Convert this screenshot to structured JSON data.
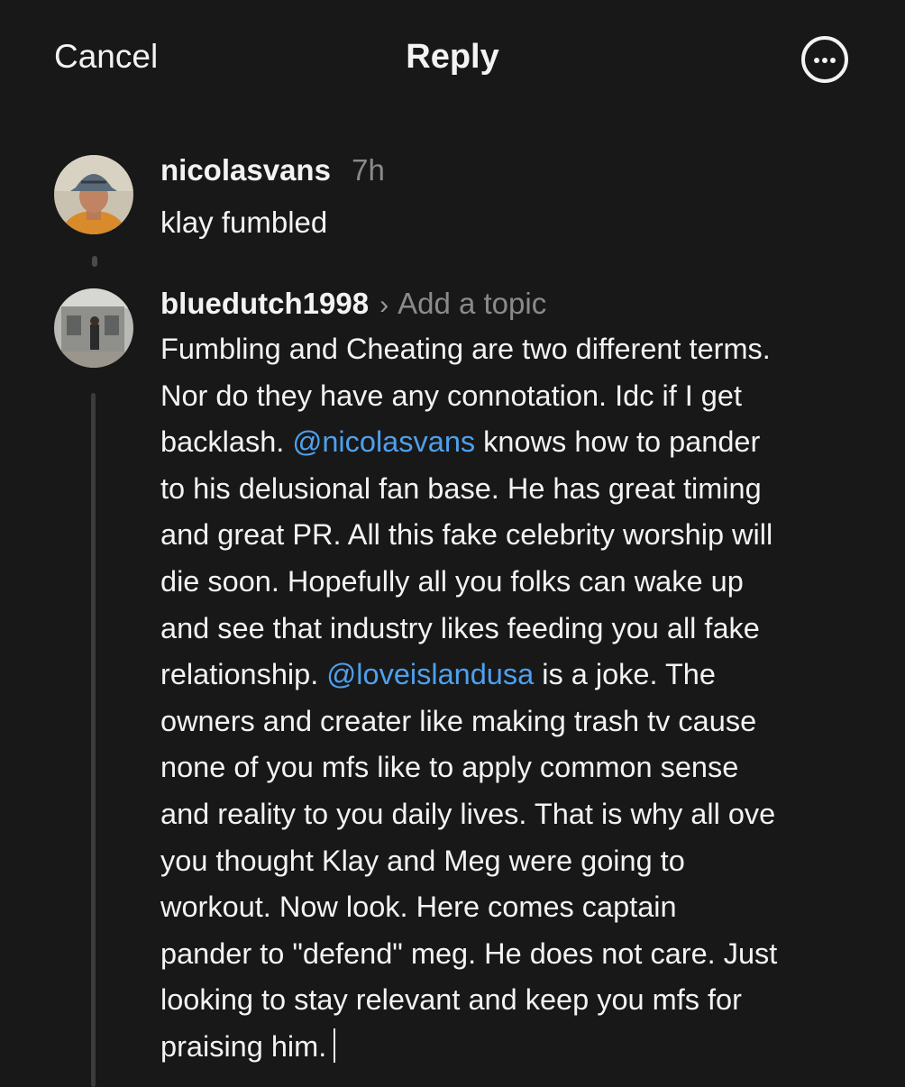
{
  "header": {
    "cancel_label": "Cancel",
    "title": "Reply",
    "more_icon": "more-options-icon"
  },
  "original_post": {
    "username": "nicolasvans",
    "time": "7h",
    "text": "klay fumbled",
    "avatar": "user-avatar"
  },
  "reply": {
    "username": "bluedutch1998",
    "topic_placeholder": "Add a topic",
    "avatar": "user-avatar",
    "lines": [
      {
        "segments": [
          {
            "text": "Fumbling and Cheating are two different terms.",
            "mention": false
          }
        ]
      },
      {
        "segments": [
          {
            "text": "Nor do they have any connotation. Idc if I get",
            "mention": false
          }
        ]
      },
      {
        "segments": [
          {
            "text": "backlash. ",
            "mention": false
          },
          {
            "text": "@nicolasvans",
            "mention": true
          },
          {
            "text": " knows how to pander",
            "mention": false
          }
        ]
      },
      {
        "segments": [
          {
            "text": "to his delusional fan base. He has great timing",
            "mention": false
          }
        ]
      },
      {
        "segments": [
          {
            "text": "and great PR. All this fake celebrity worship will",
            "mention": false
          }
        ]
      },
      {
        "segments": [
          {
            "text": "die soon. Hopefully all you folks can wake up",
            "mention": false
          }
        ]
      },
      {
        "segments": [
          {
            "text": "and see that industry likes feeding you all fake",
            "mention": false
          }
        ]
      },
      {
        "segments": [
          {
            "text": "relationship. ",
            "mention": false
          },
          {
            "text": "@loveislandusa",
            "mention": true
          },
          {
            "text": " is a joke. The",
            "mention": false
          }
        ]
      },
      {
        "segments": [
          {
            "text": "owners and creater like making trash tv cause",
            "mention": false
          }
        ]
      },
      {
        "segments": [
          {
            "text": "none of you mfs like to apply common sense",
            "mention": false
          }
        ]
      },
      {
        "segments": [
          {
            "text": "and reality to you daily lives. That is why all ove",
            "mention": false
          }
        ]
      },
      {
        "segments": [
          {
            "text": "you thought Klay and Meg were going to",
            "mention": false
          }
        ]
      },
      {
        "segments": [
          {
            "text": "workout. Now look. Here comes captain",
            "mention": false
          }
        ]
      },
      {
        "segments": [
          {
            "text": "pander to \"defend\" meg. He does not care. Just",
            "mention": false
          }
        ]
      },
      {
        "segments": [
          {
            "text": "looking to stay relevant and keep you mfs for",
            "mention": false
          }
        ]
      },
      {
        "segments": [
          {
            "text": "praising him.",
            "mention": false
          }
        ]
      }
    ]
  },
  "colors": {
    "background": "#181818",
    "text": "#f3f3f3",
    "muted": "#8a8a8a",
    "mention": "#4ea0ee",
    "thread_line": "#3c3c3c"
  }
}
